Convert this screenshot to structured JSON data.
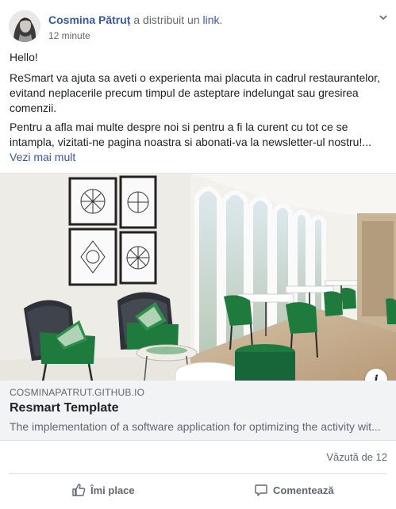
{
  "post": {
    "author": "Cosmina Pătruț",
    "action_text": " a distribuit un ",
    "action_link": "link",
    "action_end": ".",
    "time": "12 minute",
    "paragraph_1": "Hello!",
    "paragraph_2": "ReSmart va ajuta sa aveti o experienta mai placuta in cadrul restaurantelor, evitand neplacerile precum timpul de asteptare indelungat sau gresirea comenzii.",
    "paragraph_3": "Pentru a afla mai multe despre noi si pentru a fi la curent cu tot ce se intampla, vizitati-ne pagina noastra si abonati-va la newsletter-ul nostru!...",
    "see_more": "Vezi mai mult",
    "info_glyph": "i"
  },
  "link_preview": {
    "domain": "COSMINAPATRUT.GITHUB.IO",
    "title": "Resmart Template",
    "description": "The implementation of a software application for optimizing the activity wit..."
  },
  "stats": {
    "seen": "Văzută de 12"
  },
  "actions": {
    "like_label": "Îmi place",
    "comment_label": "Comentează"
  },
  "icons": {
    "menu": "chevron-down-icon",
    "like": "thumbs-up-icon",
    "comment": "comment-bubble-icon",
    "info": "info-icon"
  },
  "colors": {
    "link_blue": "#385898",
    "secondary_text": "#606770",
    "preview_bg": "#f2f3f5",
    "accent_green": "#1f7a3e"
  }
}
